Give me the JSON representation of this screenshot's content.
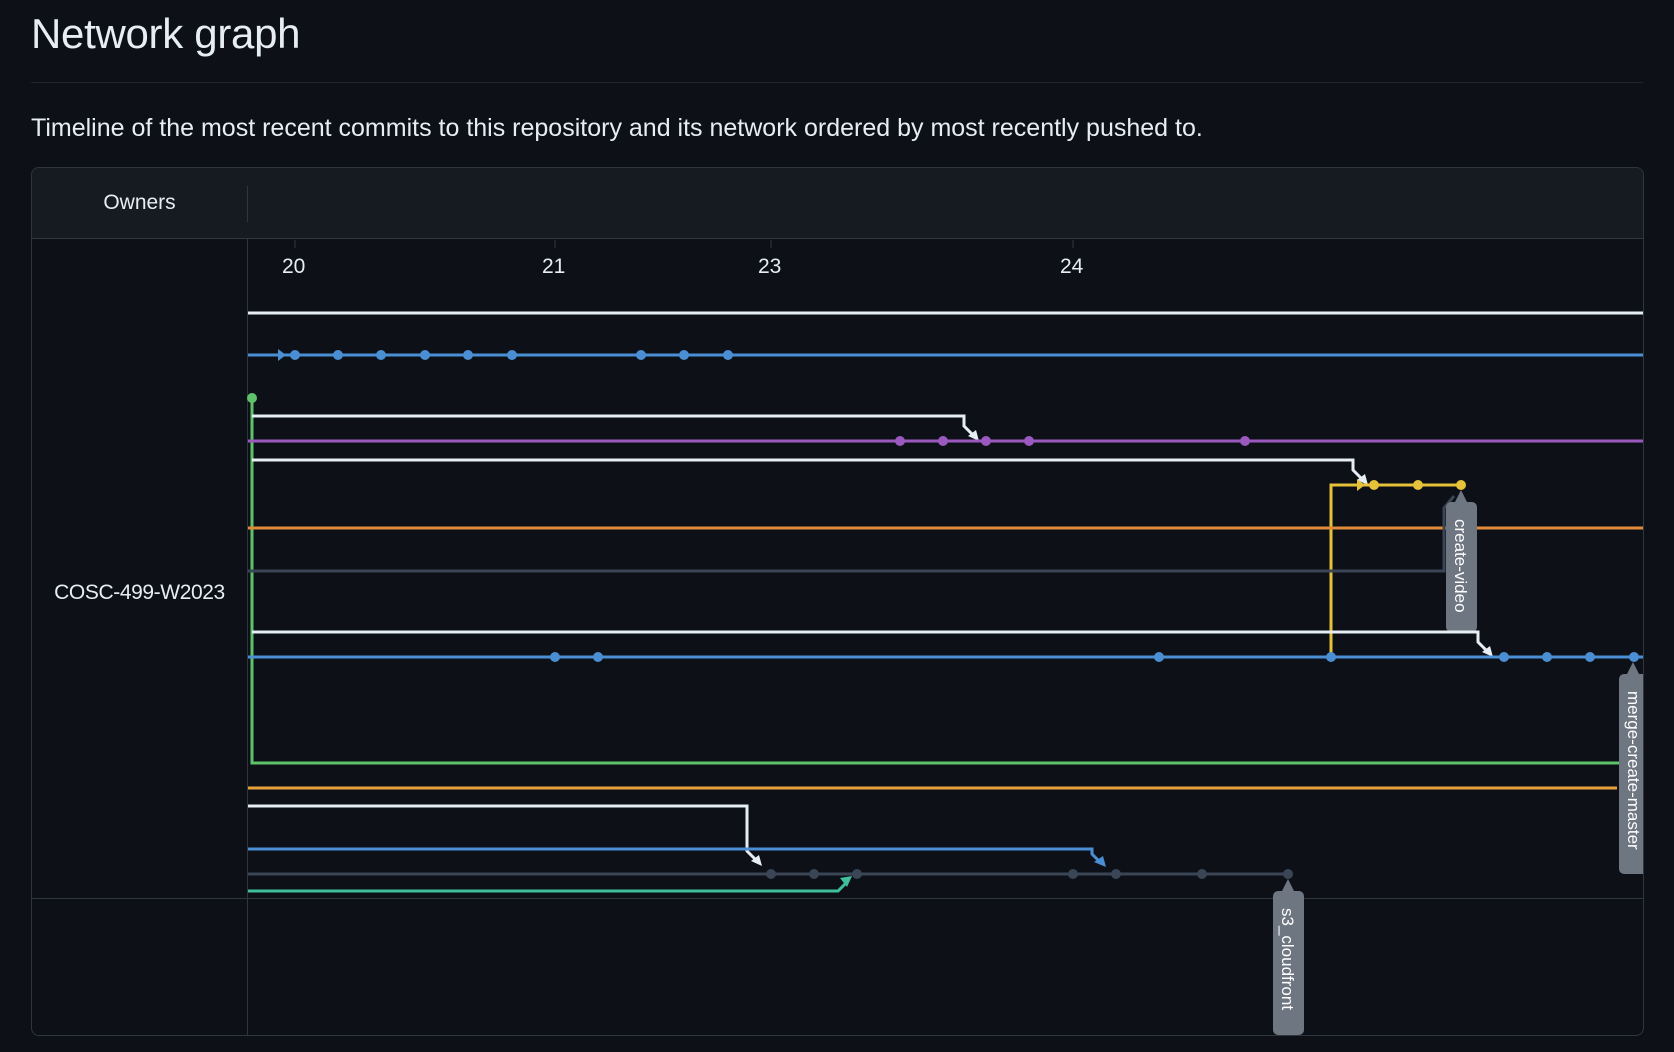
{
  "page": {
    "title": "Network graph",
    "description": "Timeline of the most recent commits to this repository and its network ordered by most recently pushed to."
  },
  "graph": {
    "owners_header": "Owners",
    "owners": [
      {
        "name": "COSC-499-W2023"
      }
    ],
    "dates": [
      "20",
      "21",
      "23",
      "24"
    ],
    "branch_tags": [
      {
        "name": "create-video"
      },
      {
        "name": "merge-create-master"
      },
      {
        "name": "s3_cloudfront"
      }
    ],
    "colors": {
      "background": "#0d1117",
      "header_background": "#161b22",
      "border": "#30363d",
      "white": "#e6edf3",
      "blue": "#4a8fd4",
      "green": "#5ec26a",
      "purple": "#9b59c0",
      "yellow": "#e6c13a",
      "orange": "#e08a3a",
      "slate": "#3a4556",
      "teal": "#3fbf9a",
      "tag": "#6e7681"
    }
  }
}
